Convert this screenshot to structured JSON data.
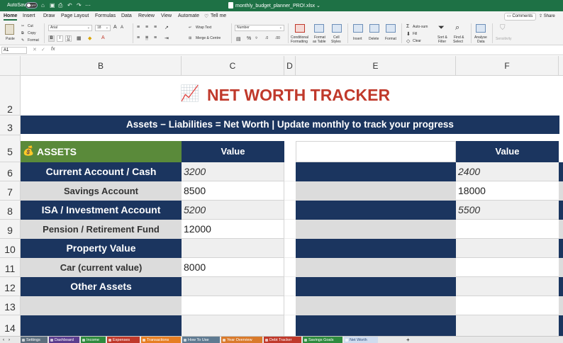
{
  "titlebar": {
    "autosave_label": "AutoSave",
    "autosave_state": "OFF",
    "file_name": "monthly_budget_planner_PRO!.xlsx",
    "file_chevron": "⌄"
  },
  "menu": {
    "tabs": [
      "Home",
      "Insert",
      "Draw",
      "Page Layout",
      "Formulas",
      "Data",
      "Review",
      "View",
      "Automate",
      "Tell me"
    ],
    "active": "Home",
    "comments": "Comments",
    "share": "Share"
  },
  "ribbon": {
    "paste": "Paste",
    "cut": "Cut",
    "copy": "Copy",
    "format_painter": "Format",
    "font_name": "Arial",
    "font_size": "18",
    "wrap_text": "Wrap Text",
    "merge_centre": "Merge & Centre",
    "number_format": "Number",
    "conditional_formatting": [
      "Conditional",
      "Formatting"
    ],
    "format_as_table": [
      "Format",
      "as Table"
    ],
    "cell_styles": [
      "Cell",
      "Styles"
    ],
    "insert": "Insert",
    "delete": "Delete",
    "format": "Format",
    "auto_sum": "Auto-sum",
    "fill": "Fill",
    "clear": "Clear",
    "sort_filter": [
      "Sort &",
      "Filter"
    ],
    "find_select": [
      "Find &",
      "Select"
    ],
    "analyse_data": [
      "Analyse",
      "Data"
    ],
    "sensitivity": "Sensitivity"
  },
  "formula_bar": {
    "name_box": "A1",
    "fx": "fx",
    "content": ""
  },
  "columns": [
    "B",
    "C",
    "D",
    "E",
    "F"
  ],
  "rows": [
    "2",
    "3",
    "5",
    "6",
    "7",
    "8",
    "9",
    "10",
    "11",
    "12",
    "13",
    "14"
  ],
  "sheet": {
    "title_icon": "📈",
    "title": "NET WORTH TRACKER",
    "subtitle": "Assets − Liabilities = Net Worth  |  Update monthly to track your progress",
    "assets_icon": "💰",
    "assets_header": "ASSETS",
    "value_header": "Value",
    "value_header_right": "Value",
    "asset_rows": [
      {
        "label": "Current Account / Cash",
        "value": "3200",
        "right_value": "2400"
      },
      {
        "label": "Savings Account",
        "value": "8500",
        "right_value": "18000"
      },
      {
        "label": "ISA / Investment Account",
        "value": "5200",
        "right_value": "5500"
      },
      {
        "label": "Pension / Retirement Fund",
        "value": "12000",
        "right_value": ""
      },
      {
        "label": "Property Value",
        "value": "",
        "right_value": ""
      },
      {
        "label": "Car (current value)",
        "value": "8000",
        "right_value": ""
      },
      {
        "label": "Other Assets",
        "value": "",
        "right_value": ""
      },
      {
        "label": "",
        "value": "",
        "right_value": ""
      },
      {
        "label": "",
        "value": "",
        "right_value": ""
      }
    ]
  },
  "sheet_tabs": [
    {
      "name": "Settings",
      "color": "#5d6f7e"
    },
    {
      "name": "Dashboard",
      "color": "#5b3d8e"
    },
    {
      "name": "Income",
      "color": "#2e8b3e"
    },
    {
      "name": "Expenses",
      "color": "#c0392b"
    },
    {
      "name": "Transactions",
      "color": "#e67e22"
    },
    {
      "name": "How To Use",
      "color": "#5f7a91"
    },
    {
      "name": "Year Overview",
      "color": "#d97a2b"
    },
    {
      "name": "Debt Tracker",
      "color": "#c0392b"
    },
    {
      "name": "Savings Goals",
      "color": "#2e8b3e"
    },
    {
      "name": "Net Worth",
      "color": "#cfdcef"
    }
  ],
  "add_sheet": "+",
  "colors": {
    "excel_green": "#1e7145",
    "title_red": "#c0392b",
    "navy": "#1b355f",
    "assets_green": "#5a8a3a",
    "row_gray": "#dcdcdc"
  }
}
